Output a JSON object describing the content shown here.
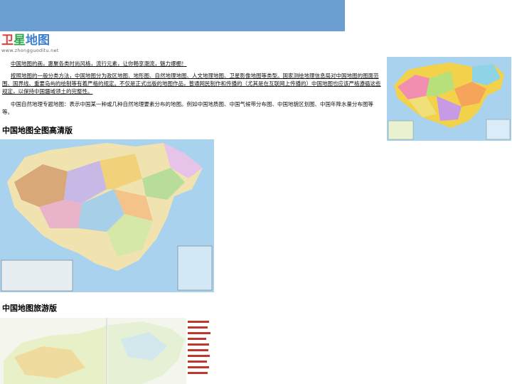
{
  "logo": {
    "title_1": "卫",
    "title_2": "星",
    "title_3": "地图",
    "subtitle": "www.zhongguoditu.net"
  },
  "intro": {
    "p1": "中国地图的画，惠聚各类时尚风格，流行元素，让你畅享潮流，魅力爆棚！",
    "p2": "按照地图的一般分类方法，中国地图分为政区地图、地形图、自然地理地图、人文地理地图、卫星影像地图等类型。国家测绘地理信息局对中国地图的图面范围、国界线、重要岛屿的绘制等有着严格的规定。不仅是正式出版的地图作品，普通网民制作和传播的（尤其是在互联网上传播的）中国地图也应该严格遵循这些规定，以保持中国疆域领土的完整性。",
    "p3": "中国自然地理专题地图：表示中国某一种或几种自然地理要素分布的地图。例如中国地质图、中国气候带分布图、中国地貌区划图、中国年降水量分布图等等。"
  },
  "sections": [
    {
      "heading": "中国地图全图高清版"
    },
    {
      "heading": "中国地图旅游版"
    }
  ],
  "colors": {
    "topbar": "#6b9fd1",
    "logo_red": "#e23d3d",
    "logo_green": "#2fa44f",
    "logo_blue": "#3a7fd0",
    "sea": "#a9d2ee"
  }
}
